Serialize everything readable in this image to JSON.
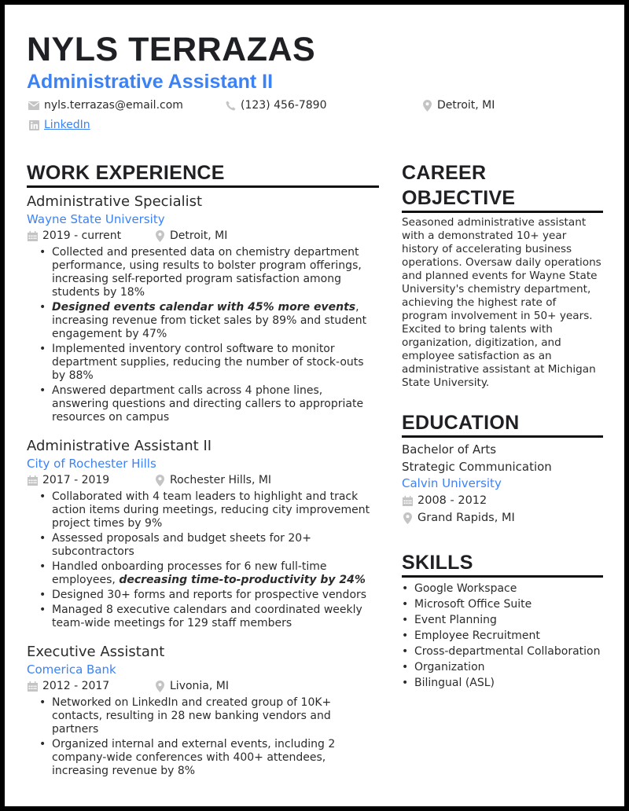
{
  "header": {
    "name": "NYLS TERRAZAS",
    "title": "Administrative Assistant II",
    "contact": {
      "email": "nyls.terrazas@email.com",
      "phone": "(123) 456-7890",
      "location": "Detroit, MI",
      "linkedin": "LinkedIn"
    },
    "icons": {
      "email": "envelope-icon",
      "phone": "phone-icon",
      "location": "map-pin-icon",
      "linkedin": "linkedin-icon"
    }
  },
  "work": {
    "heading": "WORK EXPERIENCE",
    "jobs": [
      {
        "title": "Administrative Specialist",
        "company": "Wayne State University",
        "dates": "2019 - current",
        "location": "Detroit, MI",
        "bullets": [
          {
            "bold": "",
            "text": "Collected and presented data on chemistry department performance, using results to bolster program offerings, increasing self-reported program satisfaction among students by 18%"
          },
          {
            "bold": "Designed events calendar with 45% more events",
            "text": ", increasing revenue from ticket sales by 89% and student engagement by 47%"
          },
          {
            "bold": "",
            "text": "Implemented inventory control software to monitor department supplies, reducing the number of stock-outs by 88%"
          },
          {
            "bold": "",
            "text": "Answered department calls across 4 phone lines, answering questions and directing callers to appropriate resources on campus"
          }
        ]
      },
      {
        "title": "Administrative Assistant II",
        "company": "City of Rochester Hills",
        "dates": "2017 - 2019",
        "location": "Rochester Hills, MI",
        "bullets": [
          {
            "text": "Collaborated with 4 team leaders to highlight and track action items during meetings, reducing city improvement project times by 9%"
          },
          {
            "text": "Assessed proposals and budget sheets for 20+ subcontractors"
          },
          {
            "text": "Handled onboarding processes for 6 new full-time employees, ",
            "bold_after": "decreasing time-to-productivity by 24%"
          },
          {
            "text": "Designed 30+ forms and reports for prospective vendors"
          },
          {
            "text": "Managed 8 executive calendars and coordinated weekly team-wide meetings for 129 staff members"
          }
        ]
      },
      {
        "title": "Executive Assistant",
        "company": "Comerica Bank",
        "dates": "2012 - 2017",
        "location": "Livonia, MI",
        "bullets": [
          {
            "text": "Networked on LinkedIn and created group of 10K+ contacts, resulting in 28 new banking vendors and partners"
          },
          {
            "text": "Organized internal and external events, including 2 company-wide conferences with 400+ attendees, increasing revenue by 8%"
          }
        ]
      }
    ]
  },
  "objective": {
    "heading": "CAREER OBJECTIVE",
    "text": "Seasoned administrative assistant with a demonstrated 10+ year history of accelerating business operations. Oversaw daily operations and planned events for Wayne State University's chemistry department, achieving the highest rate of program involvement in 50+ years. Excited to bring talents with organization, digitization, and employee satisfaction as an administrative assistant at Michigan State University."
  },
  "education": {
    "heading": "EDUCATION",
    "degree": "Bachelor of Arts",
    "field": "Strategic Communication",
    "school": "Calvin University",
    "dates": "2008 - 2012",
    "location": "Grand Rapids, MI"
  },
  "skills": {
    "heading": "SKILLS",
    "items": [
      "Google Workspace",
      "Microsoft Office Suite",
      "Event Planning",
      "Employee Recruitment",
      "Cross-departmental Collaboration",
      "Organization",
      "Bilingual (ASL)"
    ]
  },
  "colors": {
    "accent": "#3b82f6",
    "heading": "#1f2023",
    "text": "#2b2b2b",
    "icon": "#c4c4c4",
    "frame": "#000000"
  }
}
